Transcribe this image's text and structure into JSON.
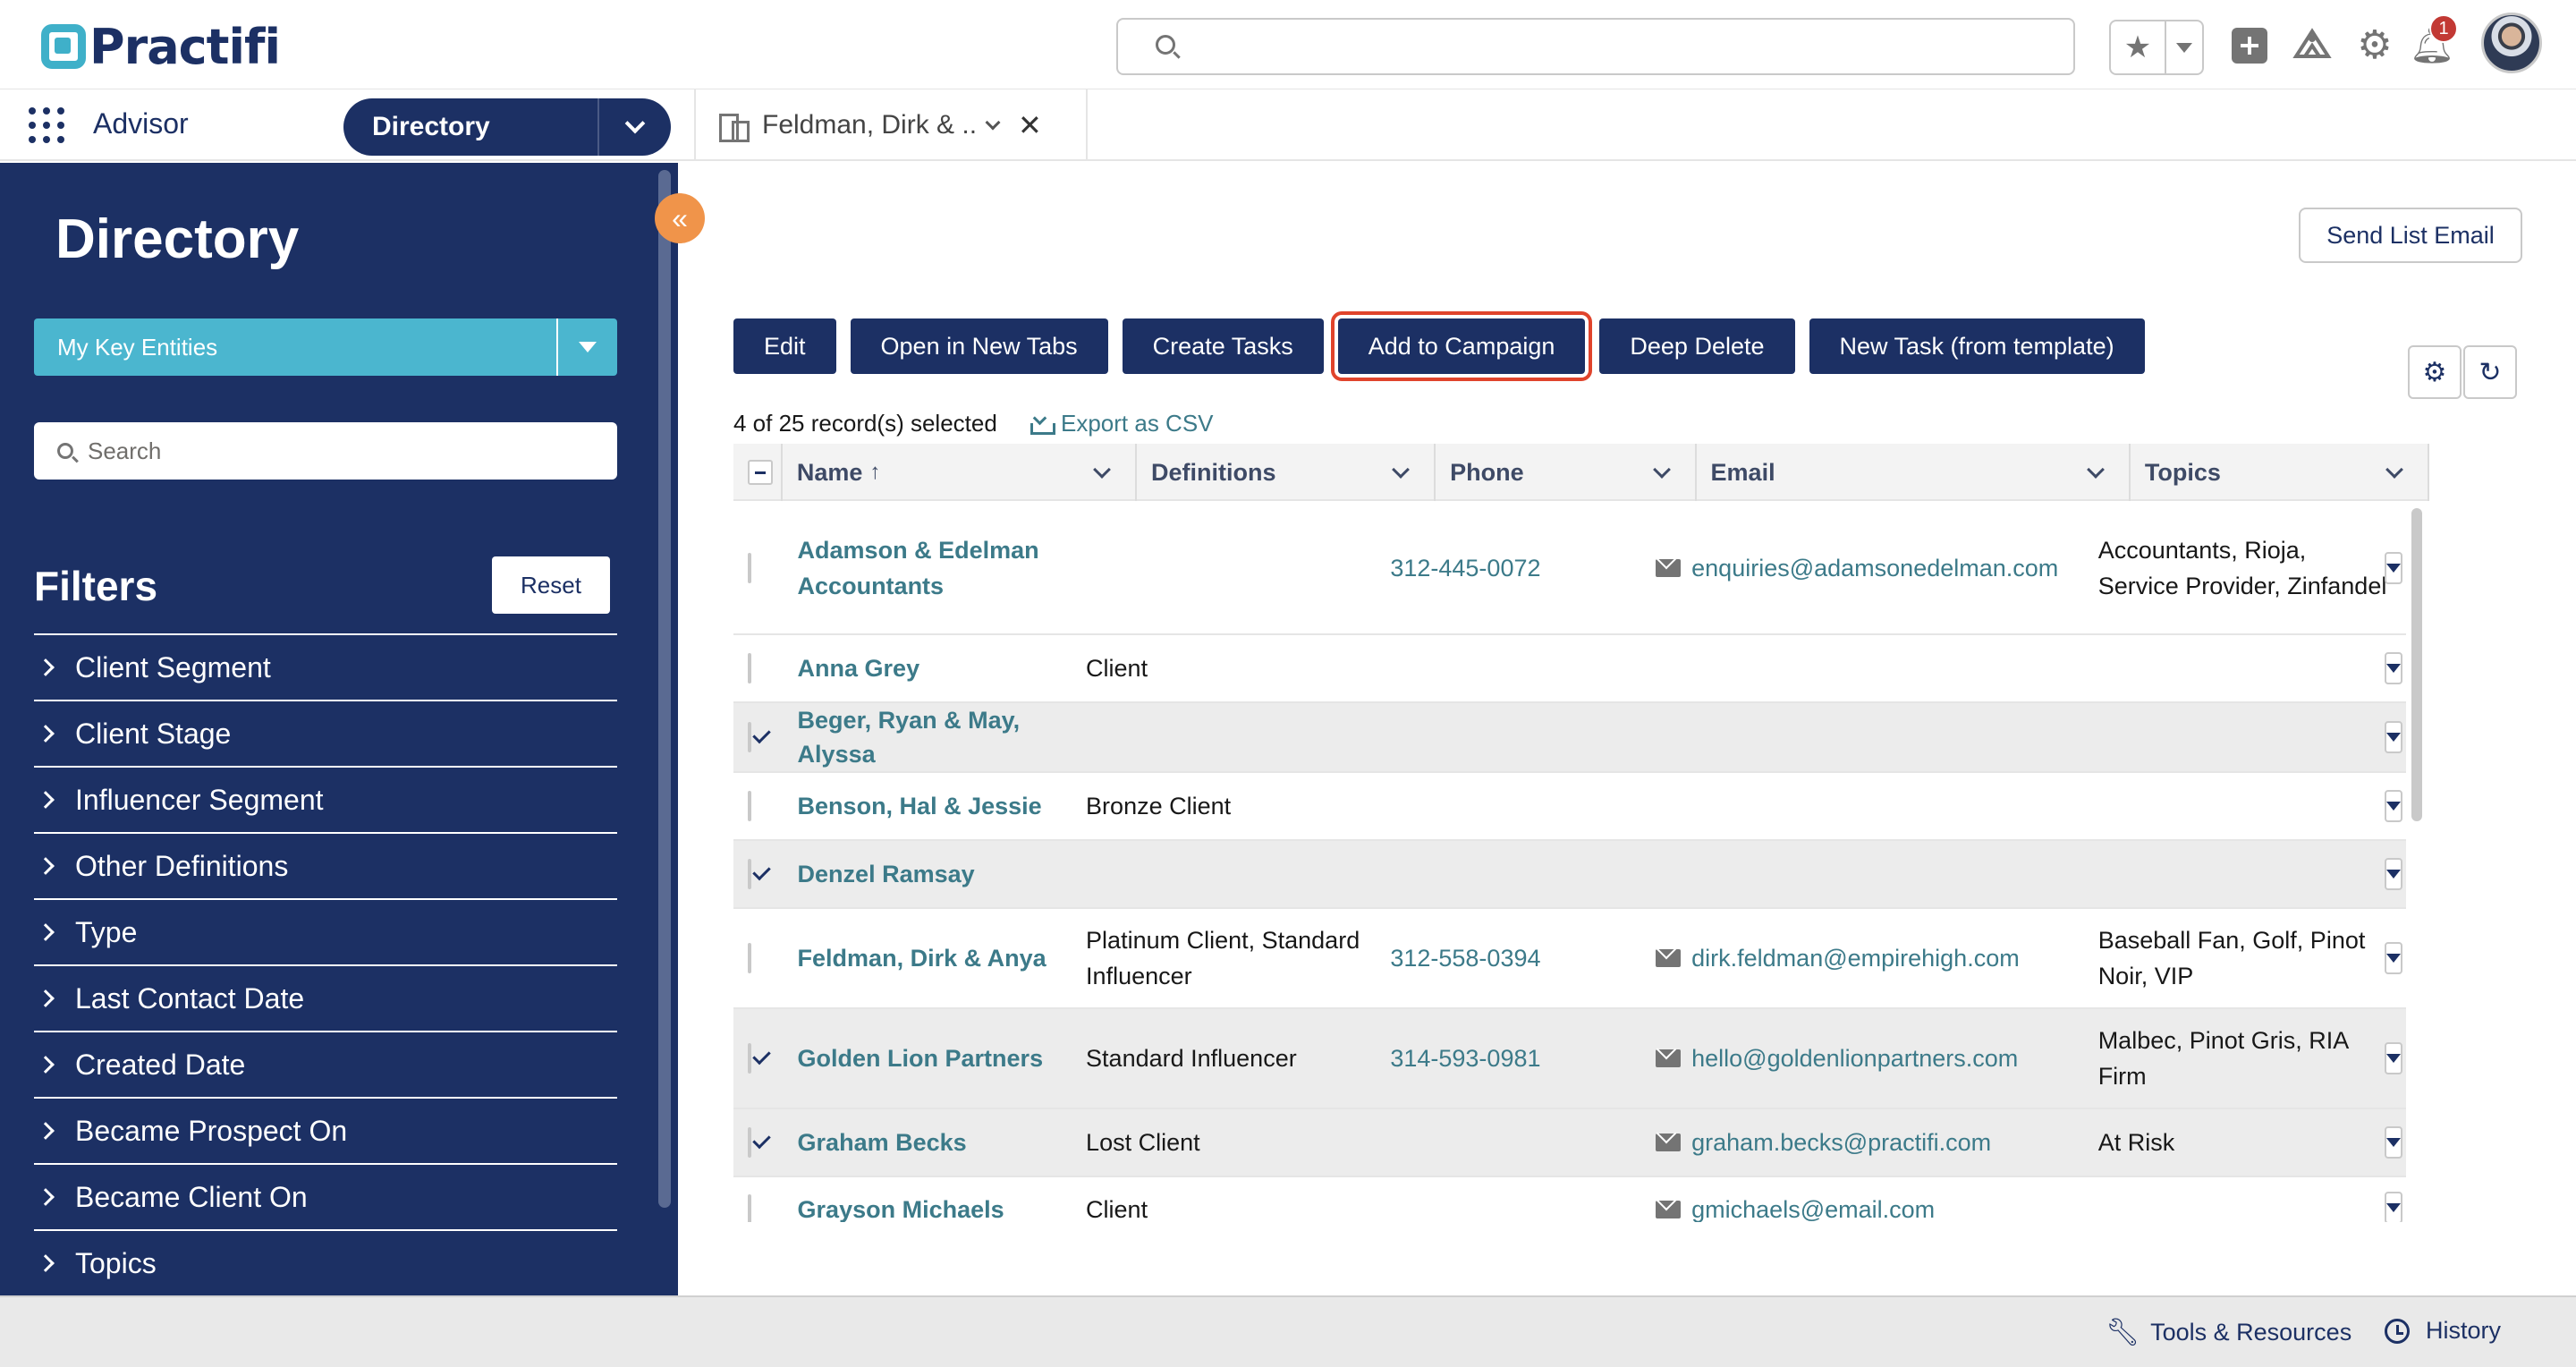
{
  "header": {
    "logo_text": "Practifi",
    "search_placeholder": "",
    "notification_count": "1"
  },
  "nav": {
    "app_name": "Advisor",
    "directory_label": "Directory",
    "record_tab_label": "Feldman, Dirk & ..."
  },
  "sidebar": {
    "title": "Directory",
    "list_view": "My Key Entities",
    "search_placeholder": "Search",
    "filters_title": "Filters",
    "reset_label": "Reset",
    "filters": [
      "Client Segment",
      "Client Stage",
      "Influencer Segment",
      "Other Definitions",
      "Type",
      "Last Contact Date",
      "Created Date",
      "Became Prospect On",
      "Became Client On",
      "Topics"
    ]
  },
  "main": {
    "send_list_email": "Send List Email",
    "actions": {
      "edit": "Edit",
      "open_new_tabs": "Open in New Tabs",
      "create_tasks": "Create Tasks",
      "add_to_campaign": "Add to Campaign",
      "deep_delete": "Deep Delete",
      "new_task_template": "New Task (from template)"
    },
    "selection_summary": "4 of 25 record(s) selected",
    "export_csv": "Export as CSV",
    "columns": {
      "name": "Name",
      "definitions": "Definitions",
      "phone": "Phone",
      "email": "Email",
      "topics": "Topics"
    },
    "rows": [
      {
        "name": "Adamson & Edelman Accountants",
        "definitions": "",
        "phone": "312-445-0072",
        "email": "enquiries@adamsonedelman.com",
        "topics": "Accountants, Rioja, Service Provider, Zinfandel",
        "selected": false
      },
      {
        "name": "Anna Grey",
        "definitions": "Client",
        "phone": "",
        "email": "",
        "topics": "",
        "selected": false
      },
      {
        "name": "Beger, Ryan & May, Alyssa",
        "definitions": "",
        "phone": "",
        "email": "",
        "topics": "",
        "selected": true
      },
      {
        "name": "Benson, Hal & Jessie",
        "definitions": "Bronze Client",
        "phone": "",
        "email": "",
        "topics": "",
        "selected": false
      },
      {
        "name": "Denzel Ramsay",
        "definitions": "",
        "phone": "",
        "email": "",
        "topics": "",
        "selected": true
      },
      {
        "name": "Feldman, Dirk & Anya",
        "definitions": "Platinum Client, Standard Influencer",
        "phone": "312-558-0394",
        "email": "dirk.feldman@empirehigh.com",
        "topics": "Baseball Fan, Golf, Pinot Noir, VIP",
        "selected": false
      },
      {
        "name": "Golden Lion Partners",
        "definitions": "Standard Influencer",
        "phone": "314-593-0981",
        "email": "hello@goldenlionpartners.com",
        "topics": "Malbec, Pinot Gris, RIA Firm",
        "selected": true
      },
      {
        "name": "Graham Becks",
        "definitions": "Lost Client",
        "phone": "",
        "email": "graham.becks@practifi.com",
        "topics": "At Risk",
        "selected": true
      },
      {
        "name": "Grayson Michaels",
        "definitions": "Client",
        "phone": "",
        "email": "gmichaels@email.com",
        "topics": "",
        "selected": false
      }
    ]
  },
  "footer": {
    "tools_resources": "Tools & Resources",
    "history": "History"
  }
}
